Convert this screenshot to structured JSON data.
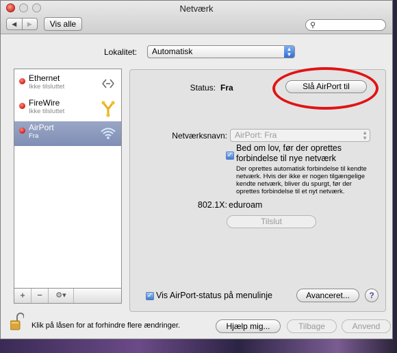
{
  "window": {
    "title": "Netværk"
  },
  "toolbar": {
    "back": "◀",
    "forward": "▶",
    "show_all": "Vis alle",
    "search_placeholder": ""
  },
  "location": {
    "label": "Lokalitet:",
    "value": "Automatisk"
  },
  "services": [
    {
      "name": "Ethernet",
      "status": "Ikke tilsluttet",
      "icon": "ethernet-icon",
      "selected": false
    },
    {
      "name": "FireWire",
      "status": "Ikke tilsluttet",
      "icon": "firewire-icon",
      "selected": false
    },
    {
      "name": "AirPort",
      "status": "Fra",
      "icon": "wifi-icon",
      "selected": true
    }
  ],
  "list_controls": {
    "add": "+",
    "remove": "−",
    "gear": "⚙▾"
  },
  "detail": {
    "status_label": "Status:",
    "status_value": "Fra",
    "toggle_airport": "Slå AirPort til",
    "network_name_label": "Netværksnavn:",
    "network_name_value": "AirPort: Fra",
    "ask_label": "Bed om lov, før der oprettes forbindelse til nye netværk",
    "ask_desc": "Der oprettes automatisk forbindelse til kendte netværk. Hvis der ikke er nogen tilgængelige kendte netværk, bliver du spurgt, før der oprettes forbindelse til et nyt netværk.",
    "x8021_label": "802.1X:",
    "x8021_value": "eduroam",
    "connect": "Tilslut",
    "menu_status": "Vis AirPort-status på menulinje",
    "advanced": "Avanceret...",
    "help": "?"
  },
  "footer": {
    "lock_text": "Klik på låsen for at forhindre flere ændringer.",
    "assist": "Hjælp mig...",
    "revert": "Tilbage",
    "apply": "Anvend"
  },
  "colors": {
    "status_red": "#d42418",
    "selection": "#8a97bc",
    "annotation_red": "#e01414"
  }
}
